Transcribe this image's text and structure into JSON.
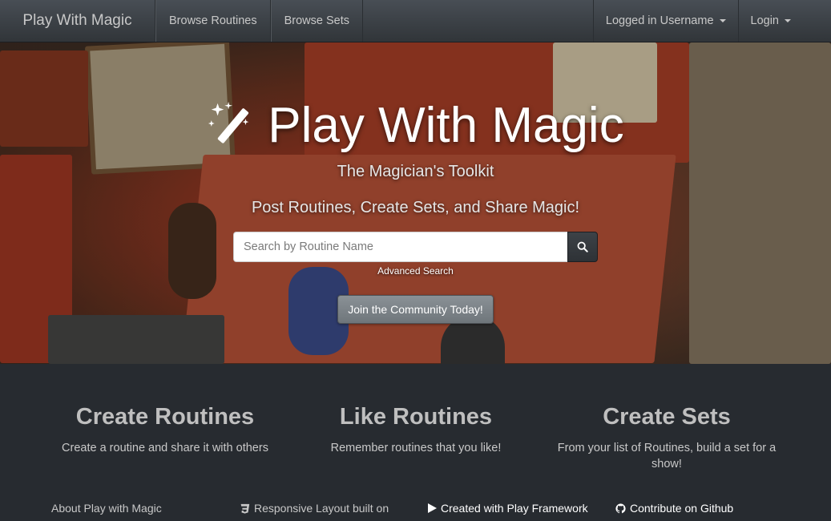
{
  "navbar": {
    "brand": "Play With Magic",
    "links": [
      "Browse Routines",
      "Browse Sets"
    ],
    "user_menu": "Logged in Username",
    "login_menu": "Login"
  },
  "hero": {
    "title": "Play With Magic",
    "subtitle": "The Magician's Toolkit",
    "tagline": "Post Routines, Create Sets, and Share Magic!",
    "search": {
      "placeholder": "Search by Routine Name",
      "value": ""
    },
    "advanced_search": "Advanced Search",
    "join_button": "Join the Community Today!"
  },
  "features": [
    {
      "title": "Create Routines",
      "text": "Create a routine and share it with others"
    },
    {
      "title": "Like Routines",
      "text": "Remember routines that you like!"
    },
    {
      "title": "Create Sets",
      "text": "From your list of Routines, build a set for a show!"
    }
  ],
  "footer": {
    "about": "About Play with Magic",
    "responsive": "Responsive Layout built on",
    "play": "Created with Play Framework",
    "github": "Contribute on Github"
  },
  "icons": {
    "brand_icon": "magic-wand-icon",
    "search_icon": "search-icon",
    "responsive_icon": "css3-icon",
    "play_icon": "play-icon",
    "github_icon": "github-icon"
  },
  "colors": {
    "navbar": "#3a3f44",
    "page_background": "#272b30",
    "text": "#c8c8c8",
    "heading": "#bfbfbf"
  }
}
